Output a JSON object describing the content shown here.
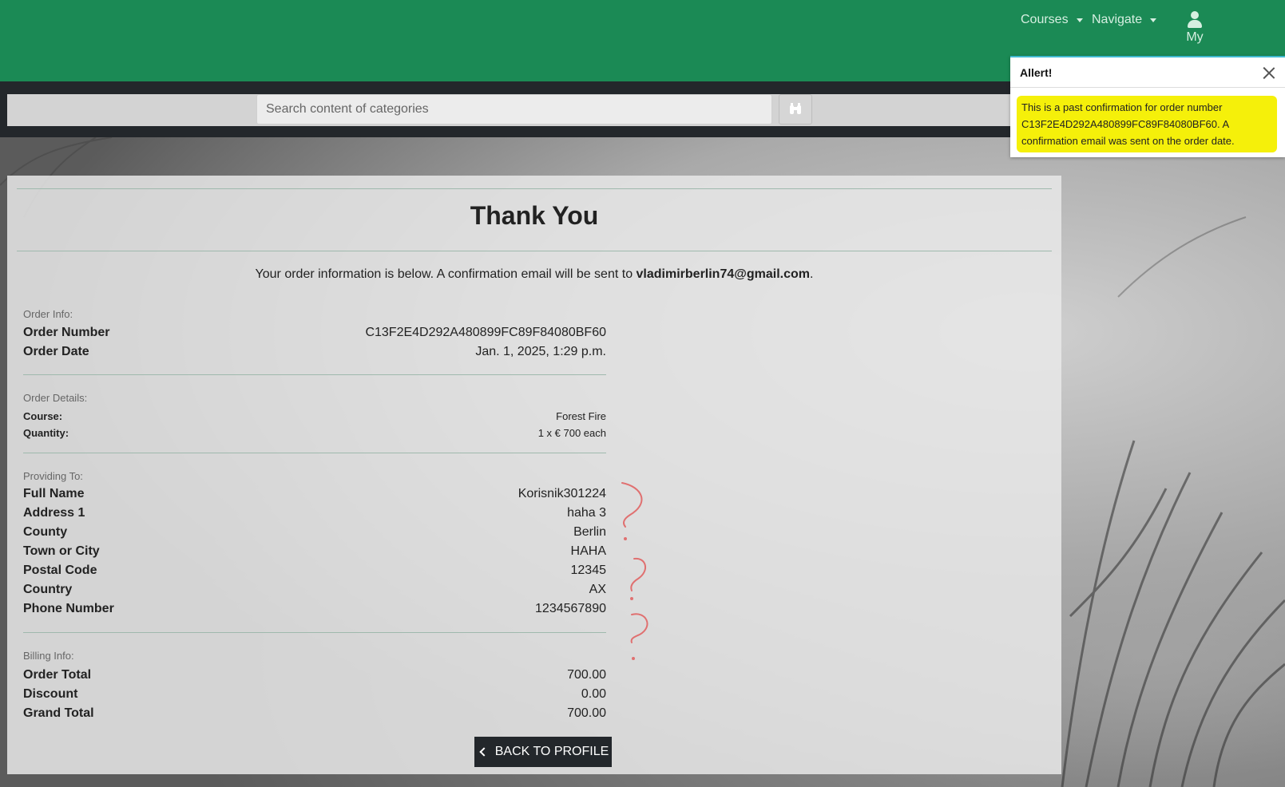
{
  "nav": {
    "courses": "Courses",
    "navigate": "Navigate",
    "account": "My"
  },
  "search": {
    "placeholder": "Search content of categories"
  },
  "alert": {
    "title": "Allert!",
    "message": "This is a past confirmation for order number C13F2E4D292A480899FC89F84080BF60. A confirmation email was sent on the order date."
  },
  "page": {
    "title": "Thank You",
    "intro_prefix": "Your order information is below. A confirmation email will be sent to ",
    "email": "vladimirberlin74@gmail.com",
    "intro_suffix": "."
  },
  "order_info": {
    "label": "Order Info:",
    "rows": [
      {
        "k": "Order Number",
        "v": "C13F2E4D292A480899FC89F84080BF60"
      },
      {
        "k": "Order Date",
        "v": "Jan. 1, 2025, 1:29 p.m."
      }
    ]
  },
  "order_details": {
    "label": "Order Details:",
    "rows": [
      {
        "k": "Course:",
        "v": "Forest Fire"
      },
      {
        "k": "Quantity:",
        "v": "1 x € 700 each"
      }
    ]
  },
  "providing": {
    "label": "Providing To:",
    "rows": [
      {
        "k": "Full Name",
        "v": "Korisnik301224"
      },
      {
        "k": "Address 1",
        "v": "haha 3"
      },
      {
        "k": "County",
        "v": "Berlin"
      },
      {
        "k": "Town or City",
        "v": "HAHA"
      },
      {
        "k": "Postal Code",
        "v": "12345"
      },
      {
        "k": "Country",
        "v": "AX"
      },
      {
        "k": "Phone Number",
        "v": "1234567890"
      }
    ]
  },
  "billing": {
    "label": "Billing Info:",
    "rows": [
      {
        "k": "Order Total",
        "v": "700.00"
      },
      {
        "k": "Discount",
        "v": "0.00"
      },
      {
        "k": "Grand Total",
        "v": "700.00"
      }
    ]
  },
  "back_button": "BACK TO PROFILE",
  "colors": {
    "brand_green": "#1b8a55",
    "dark": "#23272b",
    "highlight": "#f5f00a",
    "annotation": "#e07070"
  },
  "icons": [
    "user-icon",
    "binoculars-icon",
    "close-icon",
    "chevron-left-icon",
    "caret-down-icon"
  ]
}
